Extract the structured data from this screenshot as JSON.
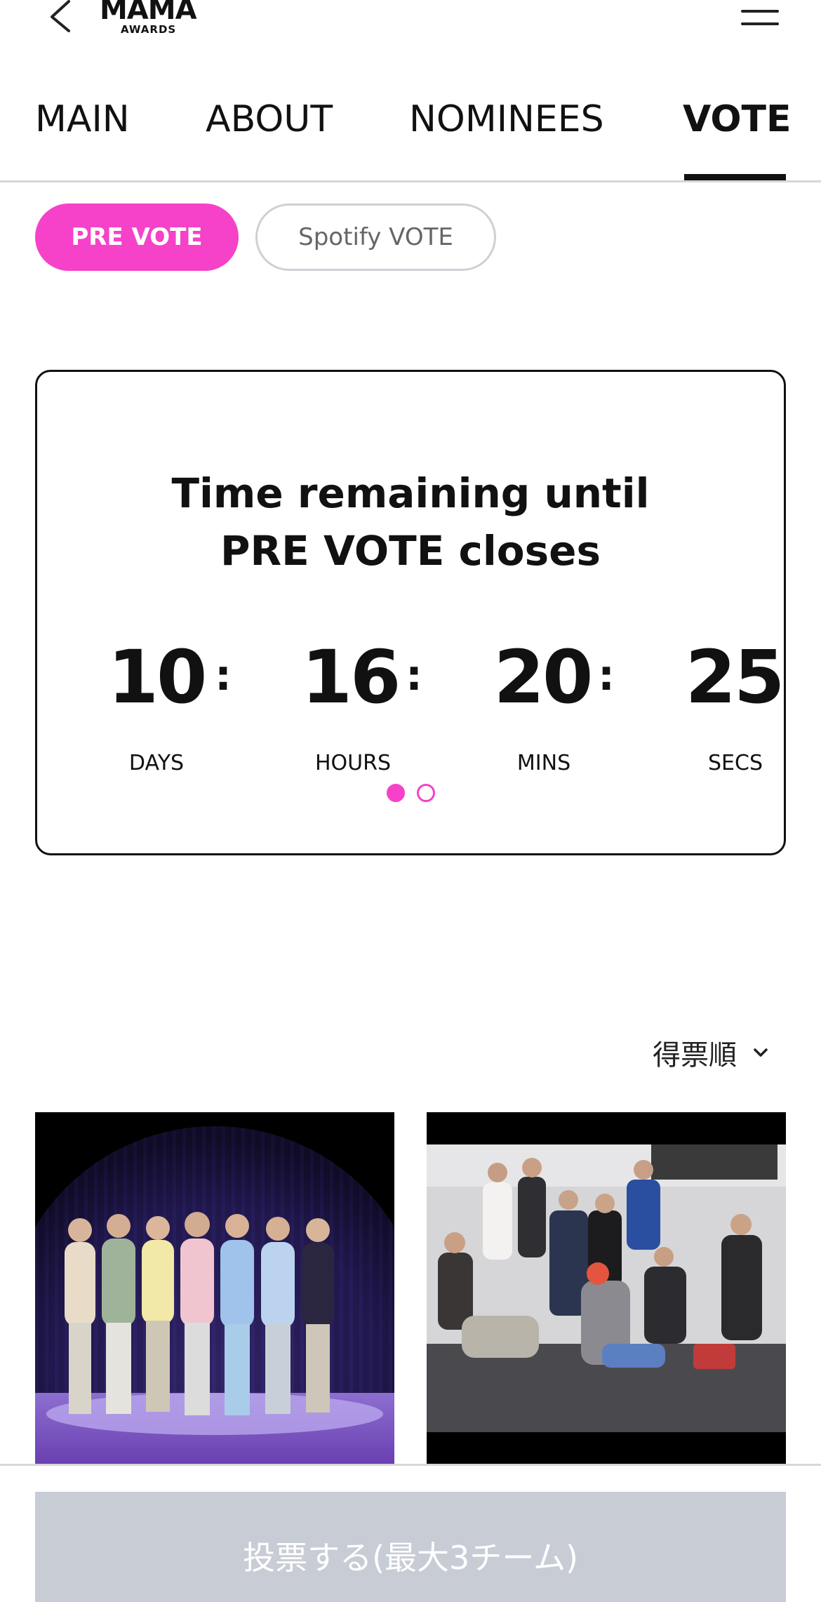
{
  "header": {
    "logo_main": "MAMA",
    "logo_sub": "AWARDS",
    "back_icon": "chevron-left-icon",
    "menu_icon": "hamburger-menu-icon"
  },
  "tabs": [
    {
      "label": "MAIN",
      "active": false
    },
    {
      "label": "ABOUT",
      "active": false
    },
    {
      "label": "NOMINEES",
      "active": false
    },
    {
      "label": "VOTE",
      "active": true
    }
  ],
  "vote_types": {
    "pre_vote": "PRE VOTE",
    "spotify_vote": "Spotify VOTE",
    "selected": "PRE VOTE"
  },
  "countdown": {
    "title_line1": "Time remaining until",
    "title_line2": "PRE VOTE closes",
    "days": "10",
    "hours": "16",
    "mins": "20",
    "secs": "25",
    "separator": ":",
    "days_label": "DAYS",
    "hours_label": "HOURS",
    "mins_label": "MINS",
    "secs_label": "SECS",
    "pager_count": 2,
    "pager_active_index": 0
  },
  "sort": {
    "label": "得票順",
    "icon": "chevron-down-icon"
  },
  "nominees": [
    {
      "image": "group-photo-seven-members-pastel-suits"
    },
    {
      "image": "group-photo-members-seated-industrial-room"
    }
  ],
  "vote_button": {
    "label": "投票する(最大3チーム)"
  },
  "colors": {
    "accent": "#f542c8",
    "disabled_button": "#c8ccd5",
    "divider": "#d6d6dc"
  }
}
